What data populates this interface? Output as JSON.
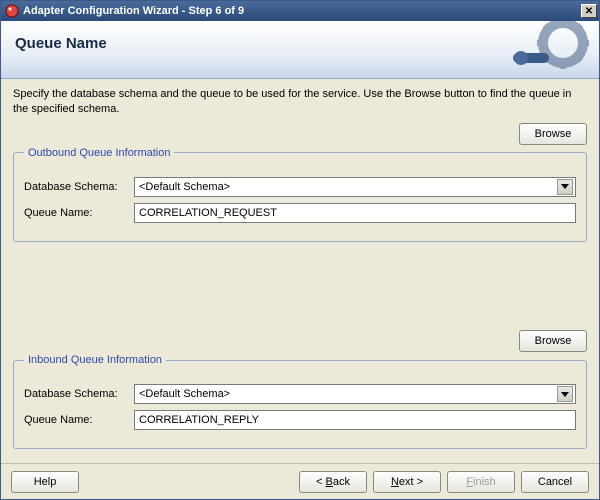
{
  "window": {
    "title": "Adapter Configuration Wizard - Step 6 of 9"
  },
  "header": {
    "page_title": "Queue Name"
  },
  "instructions": "Specify the database schema and the queue to be used for the service. Use the Browse button to find the queue in the specified schema.",
  "outbound": {
    "browse_label": "Browse",
    "legend": "Outbound Queue Information",
    "schema_label": "Database Schema:",
    "schema_value": "<Default Schema>",
    "queue_label": "Queue Name:",
    "queue_value": "CORRELATION_REQUEST"
  },
  "inbound": {
    "browse_label": "Browse",
    "legend": "Inbound Queue Information",
    "schema_label": "Database Schema:",
    "schema_value": "<Default Schema>",
    "queue_label": "Queue Name:",
    "queue_value": "CORRELATION_REPLY"
  },
  "buttons": {
    "help": "Help",
    "back_prefix": "< ",
    "back_mn": "B",
    "back_suffix": "ack",
    "next_mn": "N",
    "next_suffix": "ext >",
    "finish_mn": "F",
    "finish_suffix": "inish",
    "cancel": "Cancel"
  },
  "icons": {
    "close": "✕"
  }
}
